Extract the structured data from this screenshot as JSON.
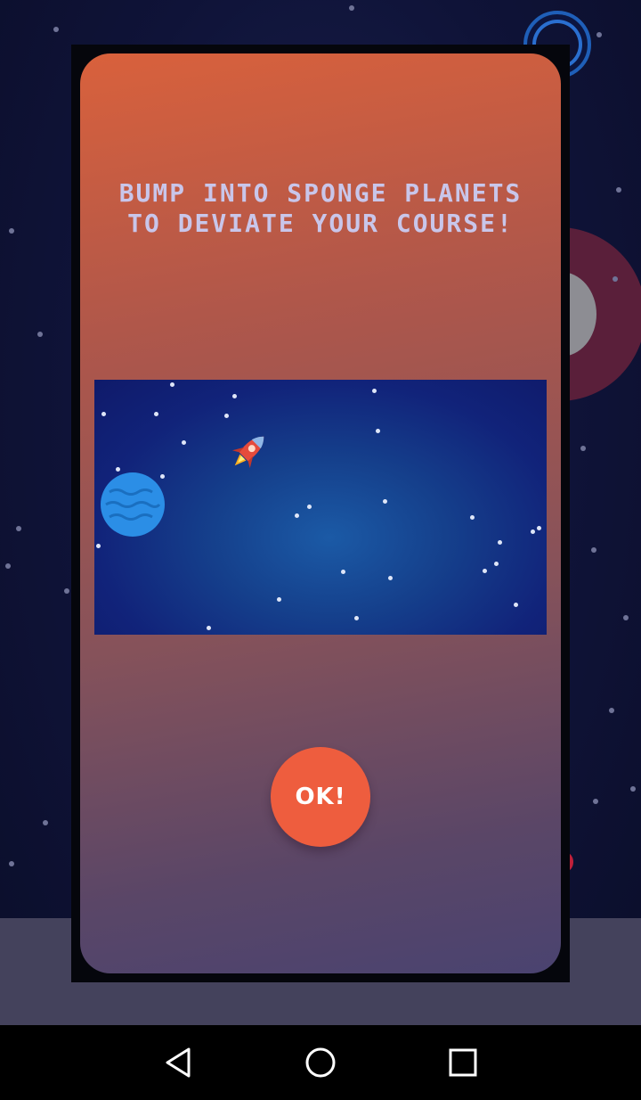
{
  "dialog": {
    "title": "BUMP INTO SPONGE PLANETS TO DEVIATE YOUR COURSE!",
    "ok_label": "OK!"
  },
  "colors": {
    "accent_button": "#ee5d3e",
    "title_text": "#c9c6ea",
    "dialog_gradient_top": "#d9613c",
    "dialog_gradient_bottom": "#4a4370",
    "preview_space": "#15408c",
    "sponge_planet": "#2b8ee6"
  },
  "preview": {
    "icons": [
      "sponge-planet-icon",
      "rocket-icon",
      "star-icon"
    ]
  },
  "nav": {
    "icons": [
      "back-icon",
      "home-icon",
      "recents-icon"
    ]
  }
}
